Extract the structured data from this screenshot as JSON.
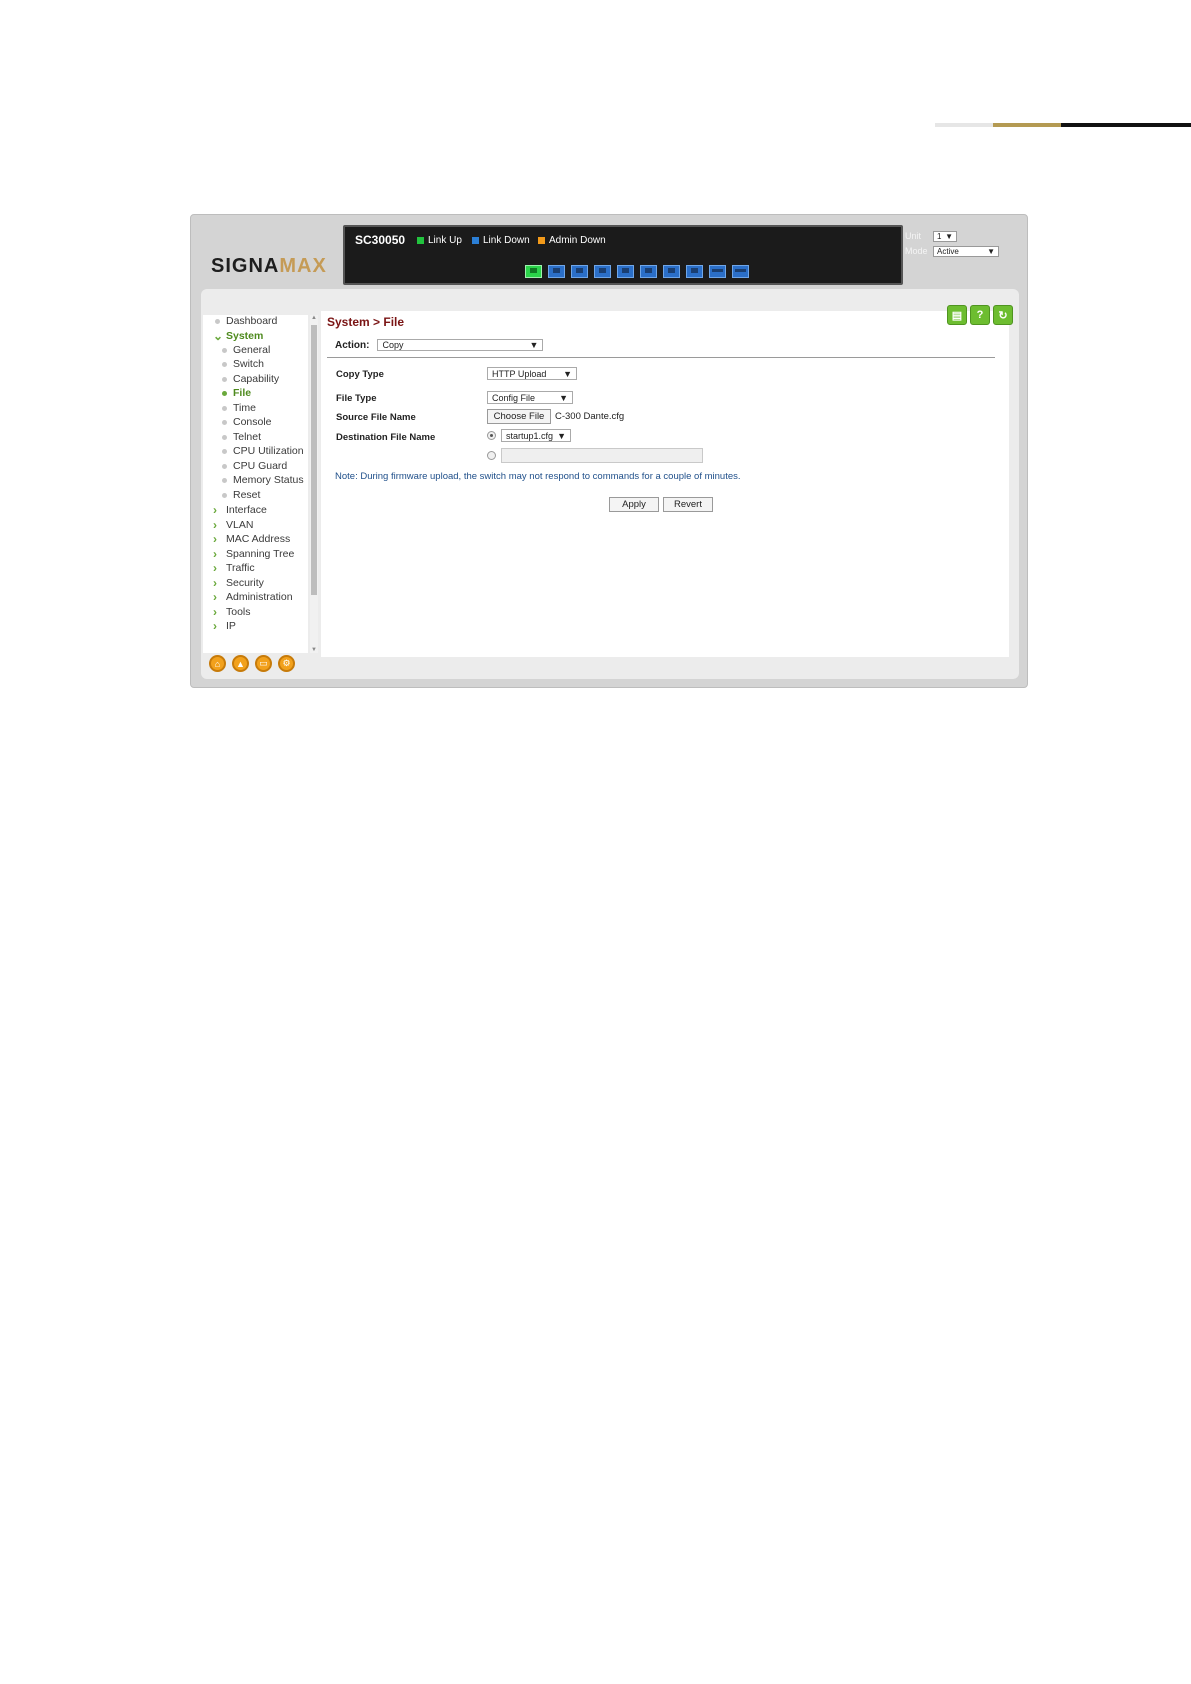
{
  "device": {
    "model": "SC30050",
    "legend": [
      {
        "label": "Link Up",
        "color": "#22c33e"
      },
      {
        "label": "Link Down",
        "color": "#2b7fd6"
      },
      {
        "label": "Admin Down",
        "color": "#f29a1a"
      }
    ],
    "unit_label": "Unit",
    "unit_value": "1",
    "mode_label": "Mode",
    "mode_value": "Active"
  },
  "logo": {
    "part1": "SIGNA",
    "part2": "MAX"
  },
  "nav": {
    "items": [
      {
        "label": "Dashboard"
      },
      {
        "label": "System"
      },
      {
        "label": "General"
      },
      {
        "label": "Switch"
      },
      {
        "label": "Capability"
      },
      {
        "label": "File"
      },
      {
        "label": "Time"
      },
      {
        "label": "Console"
      },
      {
        "label": "Telnet"
      },
      {
        "label": "CPU Utilization"
      },
      {
        "label": "CPU Guard"
      },
      {
        "label": "Memory Status"
      },
      {
        "label": "Reset"
      },
      {
        "label": "Interface"
      },
      {
        "label": "VLAN"
      },
      {
        "label": "MAC Address"
      },
      {
        "label": "Spanning Tree"
      },
      {
        "label": "Traffic"
      },
      {
        "label": "Security"
      },
      {
        "label": "Administration"
      },
      {
        "label": "Tools"
      },
      {
        "label": "IP"
      }
    ]
  },
  "page": {
    "breadcrumb": "System > File",
    "action_label": "Action:",
    "action_value": "Copy",
    "copy_type_label": "Copy Type",
    "copy_type_value": "HTTP Upload",
    "file_type_label": "File Type",
    "file_type_value": "Config File",
    "source_label": "Source File Name",
    "choose_file": "Choose File",
    "chosen_file": "C-300 Dante.cfg",
    "dest_label": "Destination File Name",
    "dest_value": "startup1.cfg",
    "note": "Note: During firmware upload, the switch may not respond to commands for a couple of minutes.",
    "apply": "Apply",
    "revert": "Revert"
  }
}
